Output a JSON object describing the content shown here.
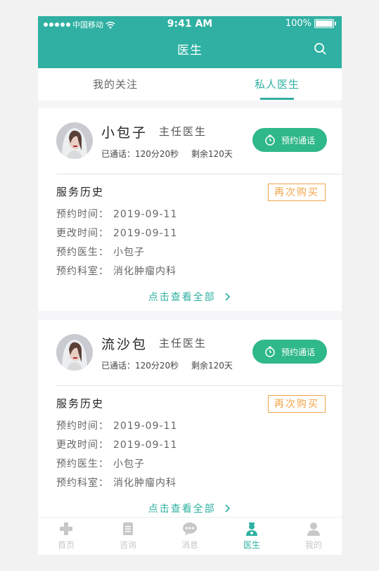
{
  "status_bar": {
    "carrier": "中国移动",
    "time": "9:41 AM",
    "battery": "100%"
  },
  "header": {
    "title": "医生",
    "search_icon": "search-icon"
  },
  "tabs": [
    {
      "label": "我的关注",
      "active": false
    },
    {
      "label": "私人医生",
      "active": true
    }
  ],
  "doctors": [
    {
      "name": "小包子",
      "title": "主任医生",
      "called": "已通话：120分20秒",
      "remaining": "剩余120天",
      "call_button": "预约通话",
      "history_title": "服务历史",
      "rebuy_button": "再次购买",
      "rows": [
        {
          "key": "预约时间：",
          "value": "2019-09-11"
        },
        {
          "key": "更改时间：",
          "value": "2019-09-11"
        },
        {
          "key": "预约医生：",
          "value": "小包子"
        },
        {
          "key": "预约科室：",
          "value": "消化肿瘤内科"
        }
      ],
      "view_all": "点击查看全部"
    },
    {
      "name": "流沙包",
      "title": "主任医生",
      "called": "已通话：120分20秒",
      "remaining": "剩余120天",
      "call_button": "预约通话",
      "history_title": "服务历史",
      "rebuy_button": "再次购买",
      "rows": [
        {
          "key": "预约时间：",
          "value": "2019-09-11"
        },
        {
          "key": "更改时间：",
          "value": "2019-09-11"
        },
        {
          "key": "预约医生：",
          "value": "小包子"
        },
        {
          "key": "预约科室：",
          "value": "消化肿瘤内科"
        }
      ],
      "view_all": "点击查看全部"
    }
  ],
  "tabbar": [
    {
      "label": "首页",
      "icon": "plus-icon",
      "active": false
    },
    {
      "label": "咨询",
      "icon": "document-icon",
      "active": false
    },
    {
      "label": "消息",
      "icon": "chat-icon",
      "active": false
    },
    {
      "label": "医生",
      "icon": "doctor-icon",
      "active": true
    },
    {
      "label": "我的",
      "icon": "person-icon",
      "active": false
    }
  ],
  "colors": {
    "primary": "#2fb0a2",
    "call_button": "#2fb88a",
    "rebuy": "#f0a54a"
  }
}
